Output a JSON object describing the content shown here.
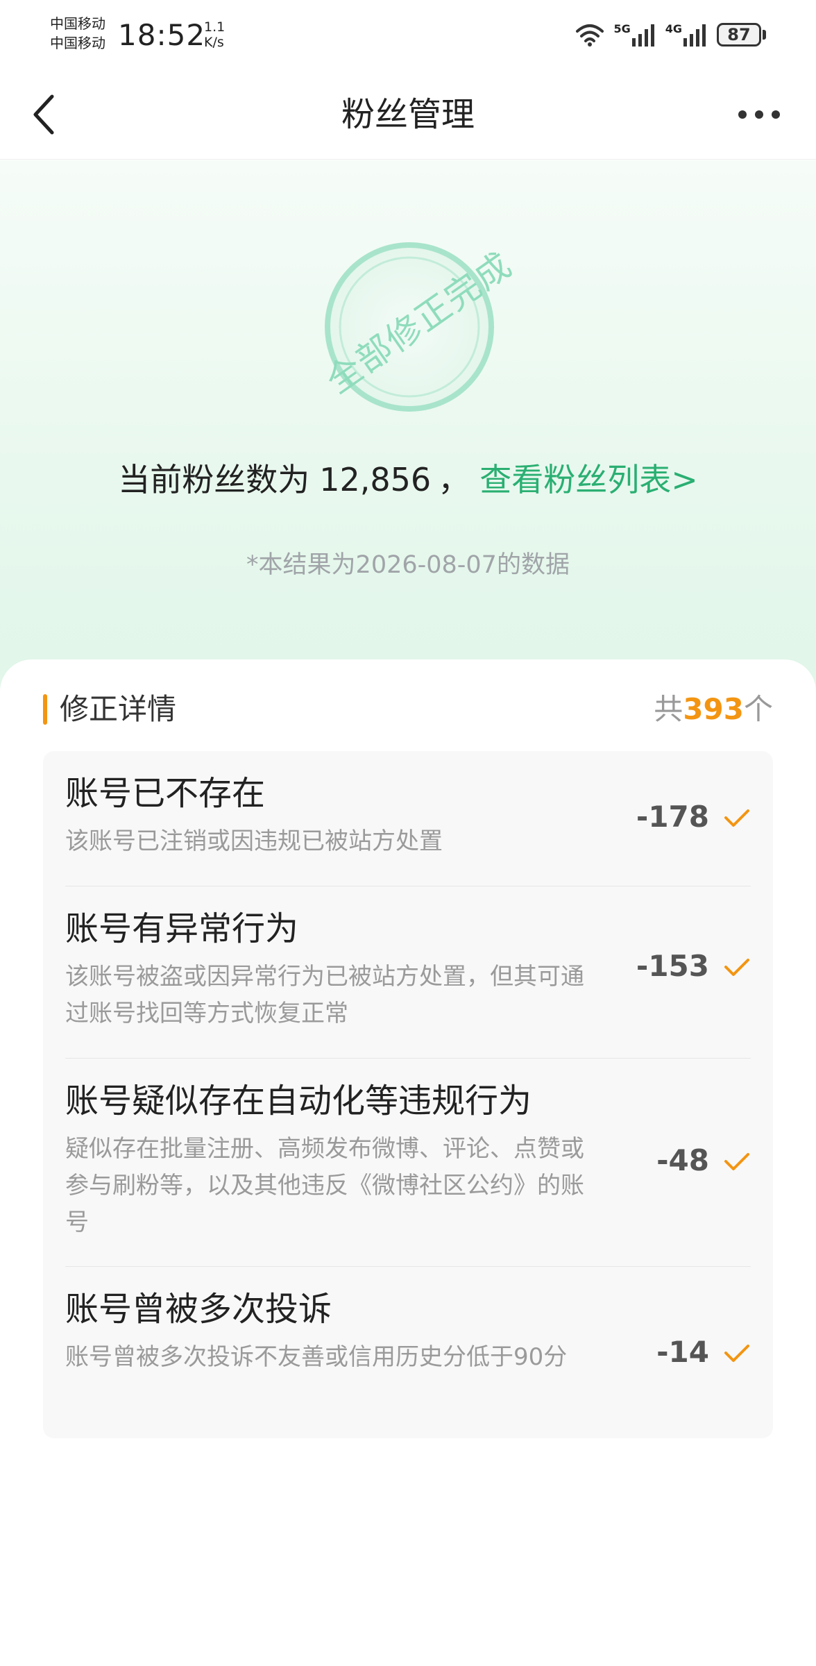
{
  "status_bar": {
    "carrier_1": "中国移动",
    "carrier_2": "中国移动",
    "time": "18:52",
    "net_speed_value": "1.1",
    "net_speed_unit": "K/s",
    "signal_1_label": "5G",
    "signal_2_label": "4G",
    "battery": "87",
    "icons": [
      "wifi-icon",
      "signal-5g-icon",
      "signal-4g-icon",
      "battery-icon"
    ]
  },
  "nav": {
    "title": "粉丝管理",
    "back_icon": "chevron-left-icon",
    "more_icon": "more-dots-icon"
  },
  "hero": {
    "stamp_text": "全部修正完成",
    "fans_prefix": "当前粉丝数为",
    "fans_count": "12,856",
    "comma": "，",
    "fans_link": "查看粉丝列表>",
    "data_note": "*本结果为2026-08-07的数据"
  },
  "details": {
    "title": "修正详情",
    "total_prefix": "共",
    "total_count": "393",
    "total_suffix": "个",
    "items": [
      {
        "title": "账号已不存在",
        "desc": "该账号已注销或因违规已被站方处置",
        "count": "-178"
      },
      {
        "title": "账号有异常行为",
        "desc": "该账号被盗或因异常行为已被站方处置，但其可通过账号找回等方式恢复正常",
        "count": "-153"
      },
      {
        "title": "账号疑似存在自动化等违规行为",
        "desc": "疑似存在批量注册、高频发布微博、评论、点赞或参与刷粉等，以及其他违反《微博社区公约》的账号",
        "count": "-48"
      },
      {
        "title": "账号曾被多次投诉",
        "desc": "账号曾被多次投诉不友善或信用历史分低于90分",
        "count": "-14"
      }
    ]
  },
  "colors": {
    "accent_green": "#2aaf72",
    "stamp_green": "#8fdcbc",
    "accent_orange": "#f39512"
  }
}
